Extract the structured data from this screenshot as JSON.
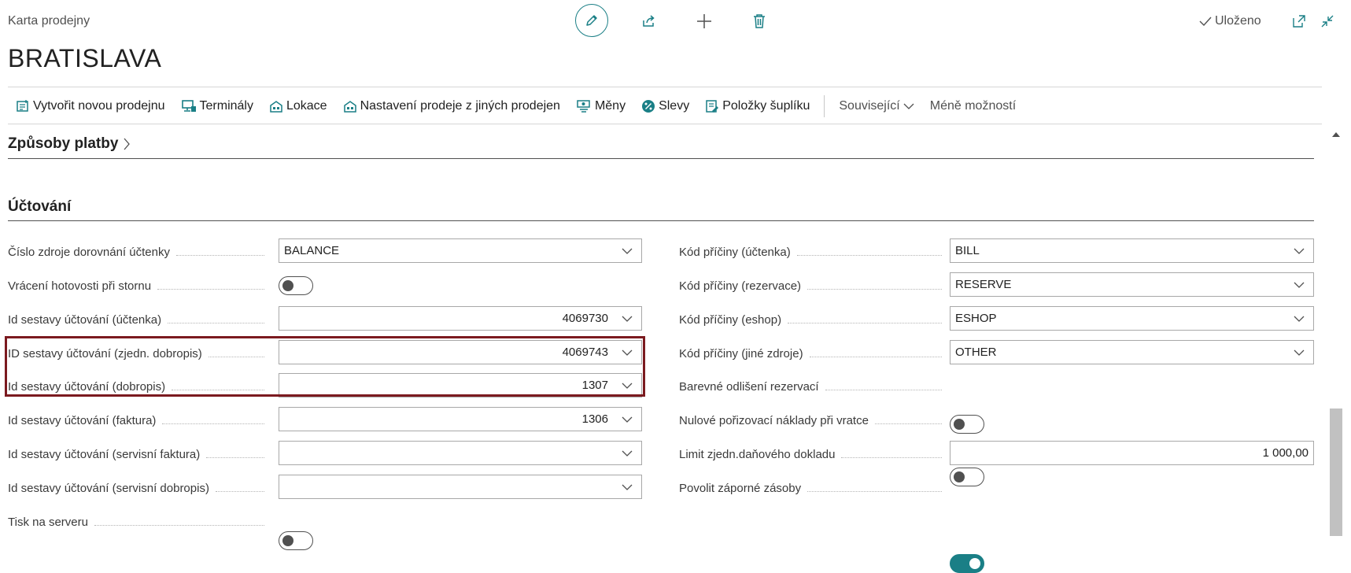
{
  "header": {
    "subtitle": "Karta prodejny",
    "title": "BRATISLAVA",
    "saved": "Uloženo"
  },
  "actions": [
    {
      "label": "Vytvořit novou prodejnu",
      "icon": "new-store-icon"
    },
    {
      "label": "Terminály",
      "icon": "terminal-icon"
    },
    {
      "label": "Lokace",
      "icon": "location-icon"
    },
    {
      "label": "Nastavení prodeje z jiných prodejen",
      "icon": "store-settings-icon"
    },
    {
      "label": "Měny",
      "icon": "currency-icon"
    },
    {
      "label": "Slevy",
      "icon": "discount-icon"
    },
    {
      "label": "Položky šuplíku",
      "icon": "drawer-items-icon"
    }
  ],
  "menus": {
    "related": "Související",
    "fewer": "Méně možností"
  },
  "sections": {
    "payment": "Způsoby platby",
    "posting": "Účtování"
  },
  "left_fields": [
    {
      "label": "Číslo zdroje dorovnání účtenky",
      "type": "select",
      "value": "BALANCE"
    },
    {
      "label": "Vrácení hotovosti při stornu",
      "type": "toggle",
      "on": false
    },
    {
      "label": "Id sestavy účtování (účtenka)",
      "type": "select",
      "value": "4069730",
      "align": "right"
    },
    {
      "label": "ID sestavy účtování (zjedn. dobropis)",
      "type": "select",
      "value": "4069743",
      "align": "right"
    },
    {
      "label": "Id sestavy účtování (dobropis)",
      "type": "select",
      "value": "1307",
      "align": "right"
    },
    {
      "label": "Id sestavy účtování (faktura)",
      "type": "select",
      "value": "1306",
      "align": "right"
    },
    {
      "label": "Id sestavy účtování (servisní faktura)",
      "type": "select",
      "value": ""
    },
    {
      "label": "Id sestavy účtování (servisní dobropis)",
      "type": "select",
      "value": ""
    },
    {
      "label": "Tisk na serveru",
      "type": "toggle",
      "on": false
    }
  ],
  "right_fields": [
    {
      "label": "Kód příčiny (účtenka)",
      "type": "select",
      "value": "BILL"
    },
    {
      "label": "Kód příčiny (rezervace)",
      "type": "select",
      "value": "RESERVE"
    },
    {
      "label": "Kód příčiny (eshop)",
      "type": "select",
      "value": "ESHOP"
    },
    {
      "label": "Kód příčiny (jiné zdroje)",
      "type": "select",
      "value": "OTHER"
    },
    {
      "label": "Barevné odlišení rezervací",
      "type": "toggle",
      "on": false
    },
    {
      "label": "Nulové pořizovací náklady při vratce",
      "type": "toggle",
      "on": false
    },
    {
      "label": "Limit zjedn.daňového dokladu",
      "type": "text",
      "value": "1 000,00",
      "align": "right"
    },
    {
      "label": "Povolit záporné zásoby",
      "type": "toggle",
      "on": true
    }
  ],
  "colors": {
    "accent": "#1a7f86",
    "highlight": "#7b1a1f"
  }
}
